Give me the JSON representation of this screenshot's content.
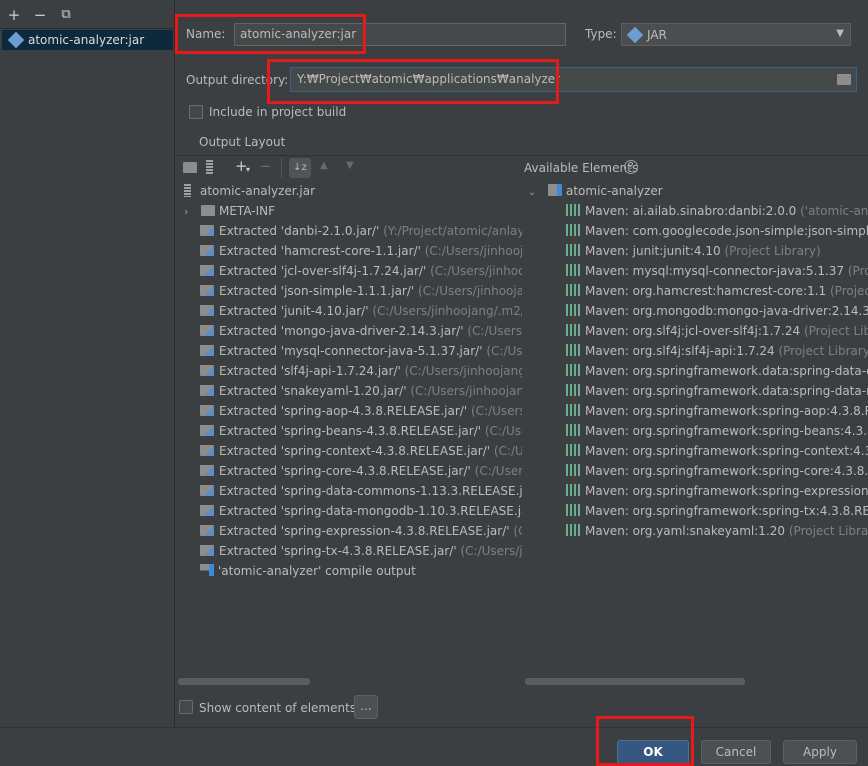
{
  "left_toolbar": {
    "add": "+",
    "remove": "−",
    "copy": "⧉"
  },
  "artifacts": [
    {
      "label": "atomic-analyzer:jar"
    }
  ],
  "form": {
    "name_label": "Name:",
    "name_value": "atomic-analyzer:jar",
    "type_label": "Type:",
    "type_value": "JAR",
    "output_label": "Output directory:",
    "output_value": "Y:₩Project₩atomic₩applications₩analyzer",
    "include_label": "Include in project build"
  },
  "tabs": {
    "output_layout": "Output Layout"
  },
  "available_elements_label": "Available Elements",
  "help_glyph": "?",
  "layout_tree": {
    "root": "atomic-analyzer.jar",
    "meta_inf": "META-INF",
    "items": [
      {
        "main": "Extracted 'danbi-2.1.0.jar/'",
        "path": "(Y:/Project/atomic/anlayzer/li"
      },
      {
        "main": "Extracted 'hamcrest-core-1.1.jar/'",
        "path": "(C:/Users/jinhoojang/.r"
      },
      {
        "main": "Extracted 'jcl-over-slf4j-1.7.24.jar/'",
        "path": "(C:/Users/jinhoojang/"
      },
      {
        "main": "Extracted 'json-simple-1.1.1.jar/'",
        "path": "(C:/Users/jinhoojang/.m"
      },
      {
        "main": "Extracted 'junit-4.10.jar/'",
        "path": "(C:/Users/jinhoojang/.m2/repos"
      },
      {
        "main": "Extracted 'mongo-java-driver-2.14.3.jar/'",
        "path": "(C:/Users/jinho"
      },
      {
        "main": "Extracted 'mysql-connector-java-5.1.37.jar/'",
        "path": "(C:/Users/jin"
      },
      {
        "main": "Extracted 'slf4j-api-1.7.24.jar/'",
        "path": "(C:/Users/jinhoojang/.m2,"
      },
      {
        "main": "Extracted 'snakeyaml-1.20.jar/'",
        "path": "(C:/Users/jinhoojang/.m2"
      },
      {
        "main": "Extracted 'spring-aop-4.3.8.RELEASE.jar/'",
        "path": "(C:/Users/jinho"
      },
      {
        "main": "Extracted 'spring-beans-4.3.8.RELEASE.jar/'",
        "path": "(C:/Users/jinh"
      },
      {
        "main": "Extracted 'spring-context-4.3.8.RELEASE.jar/'",
        "path": "(C:/Users/ji"
      },
      {
        "main": "Extracted 'spring-core-4.3.8.RELEASE.jar/'",
        "path": "(C:/Users/jinho"
      },
      {
        "main": "Extracted 'spring-data-commons-1.13.3.RELEASE.jar/'",
        "path": "(C:/Users/jin"
      },
      {
        "main": "Extracted 'spring-data-mongodb-1.10.3.RELEASE.jar/'",
        "path": "(C:/Users/"
      },
      {
        "main": "Extracted 'spring-expression-4.3.8.RELEASE.jar/'",
        "path": "(C:/Users"
      },
      {
        "main": "Extracted 'spring-tx-4.3.8.RELEASE.jar/'",
        "path": "(C:/Users/jinhooj"
      }
    ],
    "compile_output": "'atomic-analyzer' compile output"
  },
  "available": {
    "module": "atomic-analyzer",
    "items": [
      {
        "main": "Maven: ai.ailab.sinabro:danbi:2.0.0",
        "path": "('atomic-analyzer"
      },
      {
        "main": "Maven: com.googlecode.json-simple:json-simple:1.1",
        "path": ""
      },
      {
        "main": "Maven: junit:junit:4.10",
        "path": "(Project Library)"
      },
      {
        "main": "Maven: mysql:mysql-connector-java:5.1.37",
        "path": "(Project"
      },
      {
        "main": "Maven: org.hamcrest:hamcrest-core:1.1",
        "path": "(Project Libr"
      },
      {
        "main": "Maven: org.mongodb:mongo-java-driver:2.14.3",
        "path": "(Pro"
      },
      {
        "main": "Maven: org.slf4j:jcl-over-slf4j:1.7.24",
        "path": "(Project Library)"
      },
      {
        "main": "Maven: org.slf4j:slf4j-api:1.7.24",
        "path": "(Project Library)"
      },
      {
        "main": "Maven: org.springframework.data:spring-data-comm",
        "path": ""
      },
      {
        "main": "Maven: org.springframework.data:spring-data-mongo",
        "path": ""
      },
      {
        "main": "Maven: org.springframework:spring-aop:4.3.8.RELEAS",
        "path": ""
      },
      {
        "main": "Maven: org.springframework:spring-beans:4.3.8.RELE",
        "path": ""
      },
      {
        "main": "Maven: org.springframework:spring-context:4.3.8.RELE",
        "path": ""
      },
      {
        "main": "Maven: org.springframework:spring-core:4.3.8.RELEA",
        "path": ""
      },
      {
        "main": "Maven: org.springframework:spring-expression:4.3.8",
        "path": ""
      },
      {
        "main": "Maven: org.springframework:spring-tx:4.3.8.RELEASE",
        "path": ""
      },
      {
        "main": "Maven: org.yaml:snakeyaml:1.20",
        "path": "(Project Library)"
      }
    ]
  },
  "show_content_label": "Show content of elements",
  "dots_label": "...",
  "buttons": {
    "ok": "OK",
    "cancel": "Cancel",
    "apply": "Apply"
  }
}
